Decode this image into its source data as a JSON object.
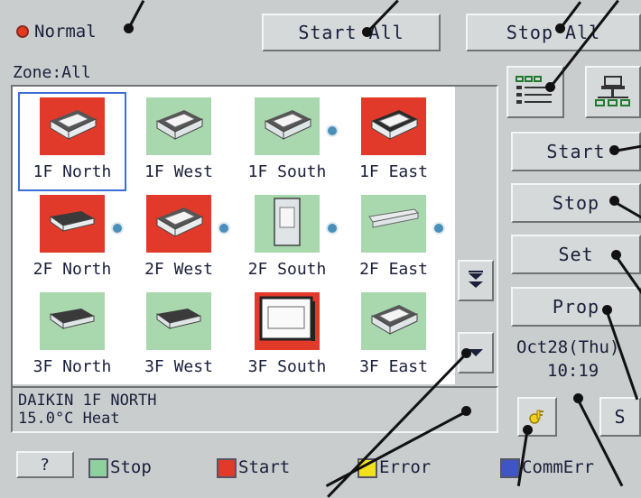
{
  "mode": {
    "label": "Normal"
  },
  "top_buttons": {
    "start_all": "Start All",
    "stop_all": "Stop All"
  },
  "zone": {
    "label": "Zone:All"
  },
  "units": [
    {
      "name": "1F North",
      "status": "start",
      "shape": "cassette",
      "selected": true
    },
    {
      "name": "1F West",
      "status": "stop",
      "shape": "cassette",
      "selected": false
    },
    {
      "name": "1F South",
      "status": "stop",
      "shape": "cassette",
      "selected": false
    },
    {
      "name": "1F East",
      "status": "start",
      "shape": "cassette-dark",
      "selected": false
    },
    {
      "name": "2F North",
      "status": "start",
      "shape": "ceiling",
      "selected": false
    },
    {
      "name": "2F West",
      "status": "start",
      "shape": "cassette",
      "selected": false
    },
    {
      "name": "2F South",
      "status": "stop",
      "shape": "floor",
      "selected": false
    },
    {
      "name": "2F East",
      "status": "stop",
      "shape": "wall",
      "selected": false
    },
    {
      "name": "3F North",
      "status": "stop",
      "shape": "ceiling",
      "selected": false
    },
    {
      "name": "3F West",
      "status": "stop",
      "shape": "ceiling",
      "selected": false
    },
    {
      "name": "3F South",
      "status": "start",
      "shape": "floor-wide",
      "selected": false
    },
    {
      "name": "3F East",
      "status": "stop",
      "shape": "cassette",
      "selected": false
    }
  ],
  "info": {
    "line1": "DAIKIN 1F NORTH",
    "line2": "15.0°C  Heat"
  },
  "side_buttons": {
    "start": "Start",
    "stop": "Stop",
    "set": "Set",
    "prop": "Prop"
  },
  "clock": {
    "date": "Oct28(Thu)",
    "time": "10:19"
  },
  "small_buttons": {
    "s": "S"
  },
  "help": {
    "label": "?"
  },
  "legend": [
    {
      "label": "Stop",
      "color": "#8fd19e"
    },
    {
      "label": "Start",
      "color": "#e23a2a"
    },
    {
      "label": "Error",
      "color": "#f2e21c"
    },
    {
      "label": "CommErr",
      "color": "#3f55c4"
    }
  ],
  "colors": {
    "start": "#e23a2a",
    "stop": "#a9d7ae",
    "select": "#3a6fd8",
    "accent_blue": "#4a8fb8"
  }
}
